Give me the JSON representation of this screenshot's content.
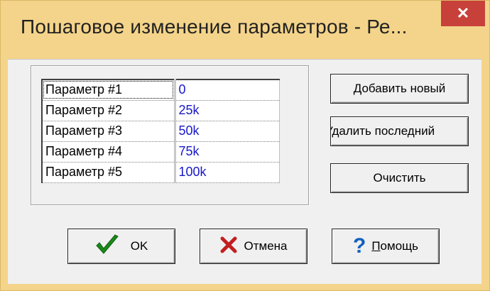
{
  "window": {
    "title": "Пошаговое изменение параметров - Ре...",
    "close_glyph": "✕"
  },
  "params": [
    {
      "name": "Параметр #1",
      "value": "0"
    },
    {
      "name": "Параметр #2",
      "value": "25k"
    },
    {
      "name": "Параметр #3",
      "value": "50k"
    },
    {
      "name": "Параметр #4",
      "value": "75k"
    },
    {
      "name": "Параметр #5",
      "value": "100k"
    }
  ],
  "side_buttons": {
    "add": "Добавить новый",
    "remove": "Удалить последний",
    "clear": "Очистить"
  },
  "bottom_buttons": {
    "ok": {
      "label": "OK",
      "icon": "check-icon",
      "color": "#1a8a1a"
    },
    "cancel": {
      "label": "Отмена",
      "icon": "x-icon",
      "color": "#c02020"
    },
    "help": {
      "label": "Помощь",
      "icon": "question-icon",
      "color": "#1060c0"
    }
  },
  "colors": {
    "frame": "#f4d48a",
    "close": "#c8403a",
    "value_text": "#1818c8"
  }
}
